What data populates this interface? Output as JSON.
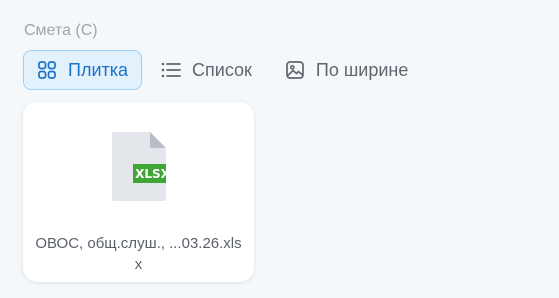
{
  "section": {
    "title": "Смета (С)"
  },
  "view_modes": {
    "tile_label": "Плитка",
    "list_label": "Список",
    "width_label": "По ширине",
    "selected": "tile"
  },
  "colors": {
    "accent": "#1a73c7",
    "active_bg": "#e3f1fd",
    "active_border": "#9fd0f7",
    "xlsx_badge": "#3fa535"
  },
  "files": [
    {
      "name": "ОВОС, общ.слуш., ...03.26.xlsx",
      "type_badge": "XLSX",
      "icon": "xlsx-file-icon"
    }
  ]
}
